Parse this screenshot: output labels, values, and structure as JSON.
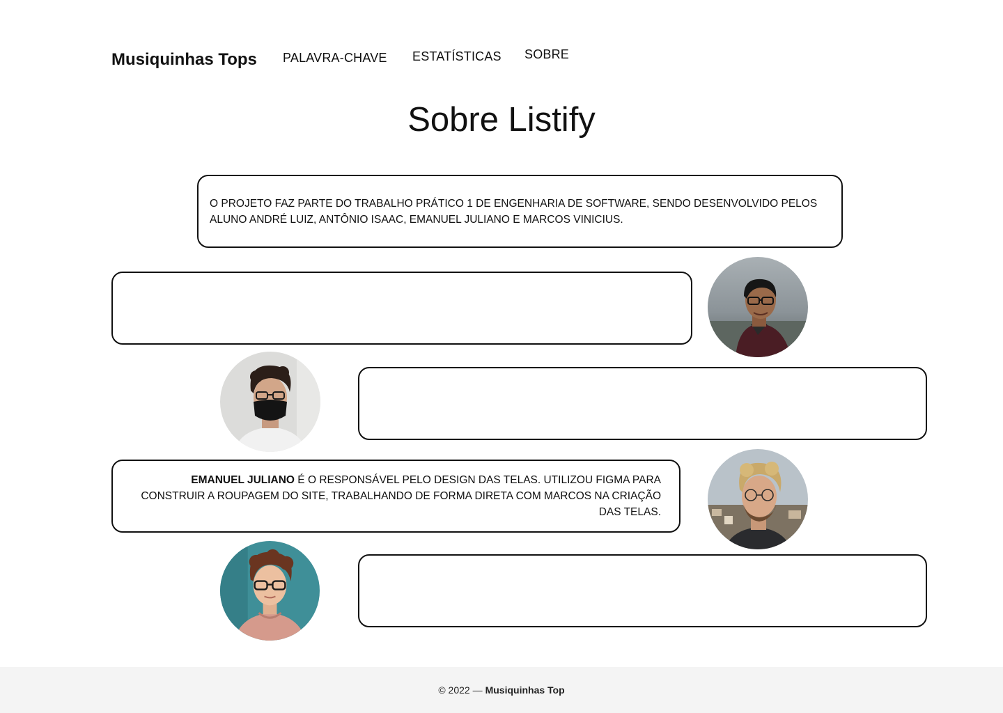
{
  "header": {
    "brand": "Musiquinhas Tops",
    "nav": [
      "PALAVRA-CHAVE",
      "ESTATÍSTICAS",
      "SOBRE"
    ]
  },
  "page": {
    "title": "Sobre Listify",
    "intro": "O projeto faz parte do trabalho prático 1 de Engenharia de Software, sendo desenvolvido pelos aluno André Luiz, Antônio Isaac, Emanuel Juliano e Marcos Vinicius."
  },
  "members": [
    {
      "name": "",
      "text": "",
      "avatar": "person-1-photo"
    },
    {
      "name": "",
      "text": "",
      "avatar": "person-2-photo"
    },
    {
      "name": "Emanuel Juliano",
      "text": " é o responsável pelo design das telas. Utilizou Figma para construir a roupagem do site, trabalhando de forma direta com Marcos na criação das telas.",
      "avatar": "person-3-photo"
    },
    {
      "name": "",
      "text": "",
      "avatar": "person-4-photo"
    }
  ],
  "footer": {
    "prefix": "© 2022 —",
    "brand": "Musiquinhas Top"
  },
  "colors": {
    "text": "#111111",
    "border": "#111111",
    "footer_bg": "#f4f4f4"
  }
}
